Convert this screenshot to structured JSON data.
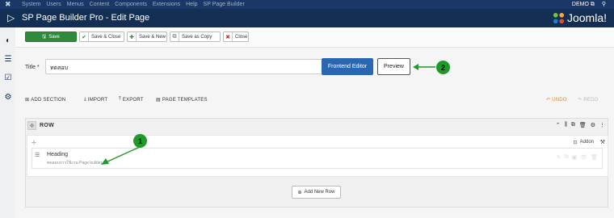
{
  "topmenu": {
    "items": [
      "System",
      "Users",
      "Menus",
      "Content",
      "Components",
      "Extensions",
      "Help",
      "SP Page Builder"
    ],
    "user_label": "DEMO"
  },
  "header": {
    "title": "SP Page Builder Pro - Edit Page",
    "brand": "Joomla!"
  },
  "toolbar": {
    "save_label": "Save",
    "save_close_label": "Save & Close",
    "save_new_label": "Save & New",
    "save_copy_label": "Save as Copy",
    "close_label": "Close"
  },
  "form": {
    "title_label": "Title *",
    "title_value": "ทดสอบ",
    "frontend_editor_label": "Frontend Editor",
    "preview_label": "Preview"
  },
  "builder_bar": {
    "add_section": "ADD SECTION",
    "import": "IMPORT",
    "export": "EXPORT",
    "page_templates": "PAGE TEMPLATES",
    "undo": "UNDO",
    "redo": "REDO"
  },
  "row": {
    "label": "ROW",
    "addon_label": "Addon",
    "addon_item": {
      "name": "Heading",
      "description": "ทดสอบการใช้งาน Page builder"
    },
    "add_new_row_label": "Add New Row"
  },
  "callouts": [
    "1",
    "2"
  ],
  "colors": {
    "header_bg": "#132f53",
    "save_green": "#2f8a3b",
    "primary_blue": "#2a67b3",
    "callout_green": "#1e9a2a",
    "undo_orange": "#e08a2b"
  }
}
